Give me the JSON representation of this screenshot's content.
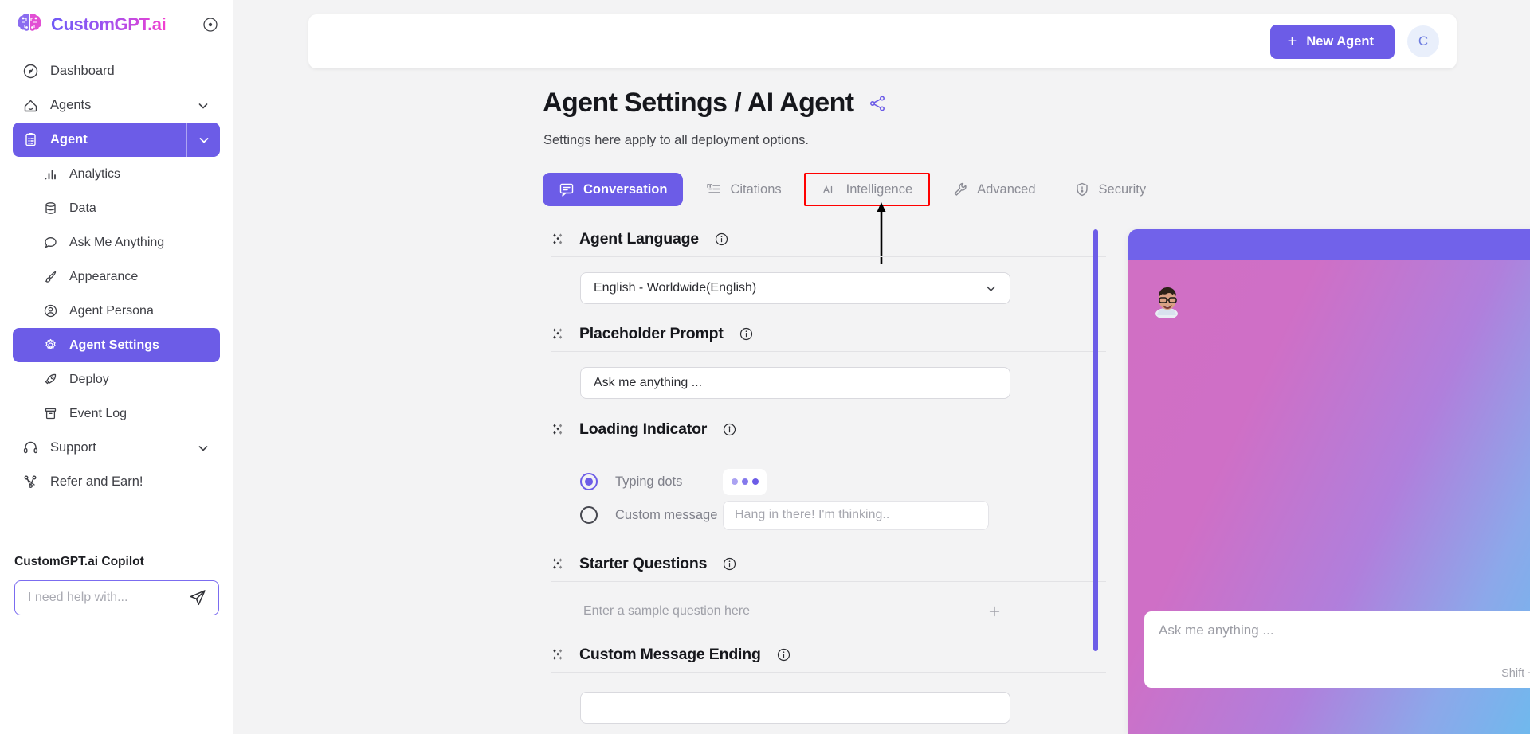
{
  "brand": {
    "name": "CustomGPT.ai",
    "collapse_icon": "collapse-circle-icon"
  },
  "sidebar": {
    "items": [
      {
        "label": "Dashboard",
        "icon": "speedometer-icon",
        "level": "main",
        "state": "default",
        "chevron": false
      },
      {
        "label": "Agents",
        "icon": "home-icon",
        "level": "main",
        "state": "default",
        "chevron": true
      },
      {
        "label": "Agent",
        "icon": "clipboard-icon",
        "level": "main",
        "state": "active",
        "chevron": true
      },
      {
        "label": "Analytics",
        "icon": "bar-chart-icon",
        "level": "sub",
        "state": "default",
        "chevron": false
      },
      {
        "label": "Data",
        "icon": "database-icon",
        "level": "sub",
        "state": "default",
        "chevron": false
      },
      {
        "label": "Ask Me Anything",
        "icon": "chat-bubble-icon",
        "level": "sub",
        "state": "default",
        "chevron": false
      },
      {
        "label": "Appearance",
        "icon": "paintbrush-icon",
        "level": "sub",
        "state": "default",
        "chevron": false
      },
      {
        "label": "Agent Persona",
        "icon": "user-circle-icon",
        "level": "sub",
        "state": "default",
        "chevron": false
      },
      {
        "label": "Agent Settings",
        "icon": "gear-icon",
        "level": "sub",
        "state": "active",
        "chevron": false
      },
      {
        "label": "Deploy",
        "icon": "rocket-icon",
        "level": "sub",
        "state": "default",
        "chevron": false
      },
      {
        "label": "Event Log",
        "icon": "archive-icon",
        "level": "sub",
        "state": "default",
        "chevron": false
      },
      {
        "label": "Support",
        "icon": "headset-icon",
        "level": "main",
        "state": "default",
        "chevron": true
      },
      {
        "label": "Refer and Earn!",
        "icon": "share-nodes-icon",
        "level": "main",
        "state": "default",
        "chevron": false
      }
    ],
    "copilot": {
      "title": "CustomGPT.ai Copilot",
      "placeholder": "I need help with...",
      "send_icon": "send-plane-icon"
    }
  },
  "header": {
    "new_agent_label": "New Agent",
    "new_agent_plus": "+",
    "avatar_initial": "C"
  },
  "page": {
    "title": "Agent Settings / AI Agent",
    "share_icon": "share-icon",
    "subtitle": "Settings here apply to all deployment options."
  },
  "tabs": [
    {
      "label": "Conversation",
      "icon": "speech-box-icon",
      "state": "active"
    },
    {
      "label": "Citations",
      "icon": "quote-list-icon",
      "state": "default"
    },
    {
      "label": "Intelligence",
      "icon": "ai-icon",
      "state": "highlighted"
    },
    {
      "label": "Advanced",
      "icon": "wrench-icon",
      "state": "default"
    },
    {
      "label": "Security",
      "icon": "shield-icon",
      "state": "default"
    }
  ],
  "annotation": {
    "highlight_color": "#ff0000",
    "arrow_color": "#000000",
    "target": "Intelligence"
  },
  "settings": {
    "agent_language": {
      "label": "Agent Language",
      "grip_icon": "drag-handle-icon",
      "info_icon": "info-icon",
      "selected": "English - Worldwide(English)",
      "chevron_icon": "chevron-down-icon"
    },
    "placeholder_prompt": {
      "label": "Placeholder Prompt",
      "grip_icon": "drag-handle-icon",
      "info_icon": "info-icon",
      "value": "Ask me anything ..."
    },
    "loading_indicator": {
      "label": "Loading Indicator",
      "grip_icon": "drag-handle-icon",
      "info_icon": "info-icon",
      "option_typing_dots": "Typing dots",
      "option_custom_message": "Custom message",
      "selected_option": "Typing dots",
      "custom_message_placeholder": "Hang in there! I'm thinking.."
    },
    "starter_questions": {
      "label": "Starter Questions",
      "grip_icon": "drag-handle-icon",
      "info_icon": "info-icon",
      "placeholder": "Enter a sample question here",
      "add_icon": "plus-icon"
    },
    "custom_message_ending": {
      "label": "Custom Message Ending",
      "grip_icon": "drag-handle-icon",
      "info_icon": "info-icon",
      "value": ""
    }
  },
  "chat_preview": {
    "close_icon": "close-icon",
    "bot_avatar": "bot-avatar-icon",
    "input_placeholder": "Ask me anything ...",
    "hint": "Shift + Enter to add a new line",
    "send_icon": "send-plane-icon"
  },
  "floating_widget": {
    "icon": "support-agent-avatar"
  },
  "colors": {
    "accent": "#6c5ce7",
    "page_bg": "#f3f3f4",
    "highlight": "#ff0000",
    "chat_header": "#7162ea"
  }
}
